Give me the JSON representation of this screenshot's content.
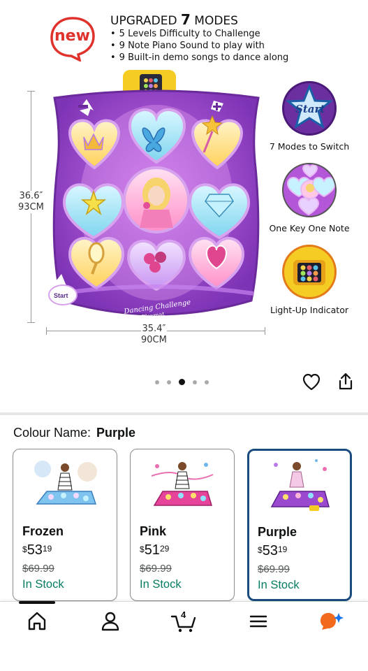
{
  "hero": {
    "badge": "new",
    "headline_pre": "UPGRADED ",
    "headline_num": "7",
    "headline_post": " MODES",
    "bullets": [
      "5 Levels Difficulty to Challenge",
      "9 Note Piano Sound to play with",
      "9 Built-in demo songs to dance along"
    ],
    "height_in": "36.6″",
    "height_cm": "93CM",
    "width_in": "35.4″",
    "width_cm": "90CM",
    "mat_title": "Dancing Challenge",
    "mat_subtitle": "Playmat",
    "mat_start": "Start",
    "features": [
      {
        "icon": "start-star-icon",
        "label": "7 Modes to Switch",
        "inner": "Start"
      },
      {
        "icon": "mat-closeup-icon",
        "label": "One Key One Note"
      },
      {
        "icon": "light-up-panel-icon",
        "label": "Light-Up Indicator"
      }
    ],
    "carousel_total": 5,
    "carousel_active": 3
  },
  "colour": {
    "label": "Colour Name:",
    "value": "Purple"
  },
  "swatches": [
    {
      "name": "Frozen",
      "currency": "$",
      "price_whole": "53",
      "price_cents": "19",
      "old_price": "$69.99",
      "stock": "In Stock",
      "selected": false
    },
    {
      "name": "Pink",
      "currency": "$",
      "price_whole": "51",
      "price_cents": "29",
      "old_price": "$69.99",
      "stock": "In Stock",
      "selected": false
    },
    {
      "name": "Purple",
      "currency": "$",
      "price_whole": "53",
      "price_cents": "19",
      "old_price": "$69.99",
      "stock": "In Stock",
      "selected": true
    }
  ],
  "nav": {
    "items": [
      "home-icon",
      "account-icon",
      "cart-icon",
      "menu-icon",
      "rufus-icon"
    ],
    "cart_count": "4"
  },
  "colors": {
    "accent_selected": "#1b4c80",
    "in_stock": "#067d62",
    "badge_red": "#e0322c",
    "mat_purple": "#8a3fc0"
  }
}
